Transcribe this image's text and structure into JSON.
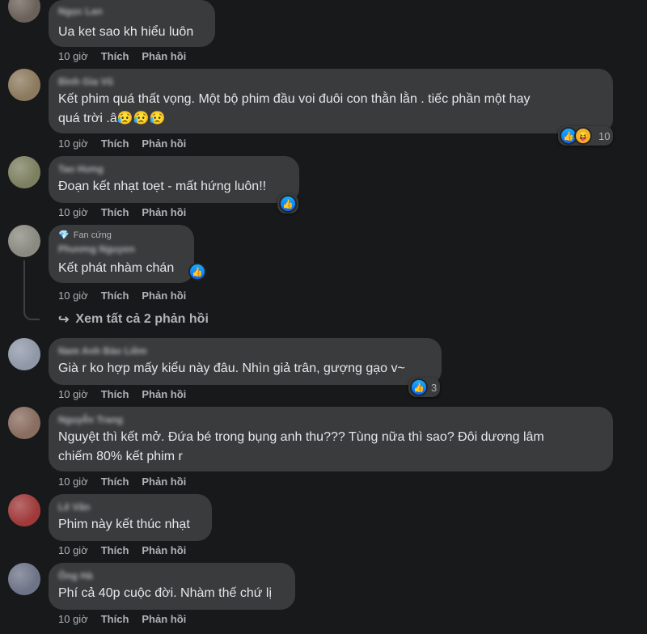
{
  "colors": {
    "background": "#18191a",
    "bubble": "#3a3b3c",
    "text": "#e4e6eb",
    "muted": "#b0b3b8",
    "like_blue": "#0866ff",
    "haha_yellow": "#f7b125"
  },
  "comments": [
    {
      "name": "Ngọc Lan",
      "text": "Ua ket sao kh hiểu luôn",
      "time": "10 giờ",
      "like": "Thích",
      "reply": "Phản hồi"
    },
    {
      "name": "Bình Gia Vũ",
      "text_lines": [
        "Kết phim quá thất vọng. Một bộ phim đầu voi đuôi con thằn lằn . tiếc phần một hay",
        "quá trời .â😥😥😥"
      ],
      "time": "10 giờ",
      "like": "Thích",
      "reply": "Phản hồi",
      "reactions": {
        "icons": [
          "like-icon",
          "haha-icon"
        ],
        "count": "10"
      }
    },
    {
      "name": "Tao Hưng",
      "text": "Đoạn kết nhạt toẹt - mất hứng luôn!!",
      "time": "10 giờ",
      "like": "Thích",
      "reply": "Phản hồi",
      "reactions": {
        "icons": [
          "like-icon"
        ]
      }
    },
    {
      "badge": "Fan cứng",
      "name": "Phương Nguyen",
      "text": "Kết phát nhàm chán",
      "time": "10 giờ",
      "like": "Thích",
      "reply": "Phản hồi",
      "reactions": {
        "icons": [
          "like-icon"
        ]
      }
    },
    {
      "name": "Nam Anh Bảo Liêm",
      "text": "Già r ko hợp mấy kiểu này đâu. Nhìn giả trân, gượng gạo v~",
      "time": "10 giờ",
      "like": "Thích",
      "reply": "Phản hồi",
      "reactions": {
        "icons": [
          "like-icon"
        ],
        "count": "3"
      }
    },
    {
      "name": "Nguyễn Trang",
      "text_lines": [
        "Nguyệt thì kết mở. Đứa bé trong bụng anh thu??? Tùng nữa thì sao? Đôi dương lâm",
        "chiếm 80% kết phim r"
      ],
      "time": "10 giờ",
      "like": "Thích",
      "reply": "Phản hồi"
    },
    {
      "name": "Lê Vân",
      "text": "Phim này kết thúc nhạt",
      "time": "10 giờ",
      "like": "Thích",
      "reply": "Phản hồi"
    },
    {
      "name": "Ông Hà",
      "text": "Phí cả 40p cuộc đời. Nhàm thế chứ lị",
      "time": "10 giờ",
      "like": "Thích",
      "reply": "Phản hồi"
    }
  ],
  "view_replies": {
    "icon": "reply-arrow-icon",
    "label": "Xem tất cả 2 phản hồi"
  }
}
